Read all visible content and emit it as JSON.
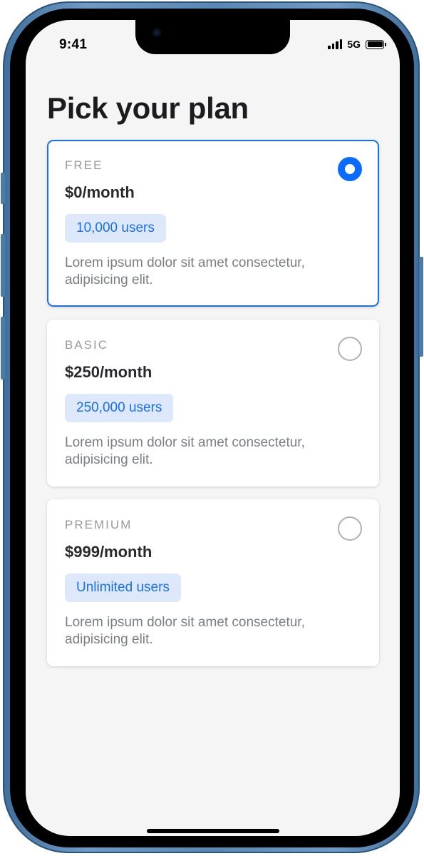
{
  "status_bar": {
    "time": "9:41",
    "network": "5G",
    "signal_icon": "signal-bars-icon",
    "battery_icon": "battery-icon",
    "battery_level": 1.0
  },
  "page": {
    "title": "Pick your plan"
  },
  "colors": {
    "accent": "#1a6ff0",
    "badge_bg": "#dde9fb",
    "screen_bg": "#f5f5f5",
    "frame": "#5a88b4"
  },
  "plans": [
    {
      "name": "FREE",
      "price": "$0/month",
      "badge": "10,000 users",
      "description": "Lorem ipsum dolor sit amet consectetur, adipisicing elit.",
      "selected": true
    },
    {
      "name": "BASIC",
      "price": "$250/month",
      "badge": "250,000 users",
      "description": "Lorem ipsum dolor sit amet consectetur, adipisicing elit.",
      "selected": false
    },
    {
      "name": "PREMIUM",
      "price": "$999/month",
      "badge": "Unlimited users",
      "description": "Lorem ipsum dolor sit amet consectetur, adipisicing elit.",
      "selected": false
    }
  ]
}
